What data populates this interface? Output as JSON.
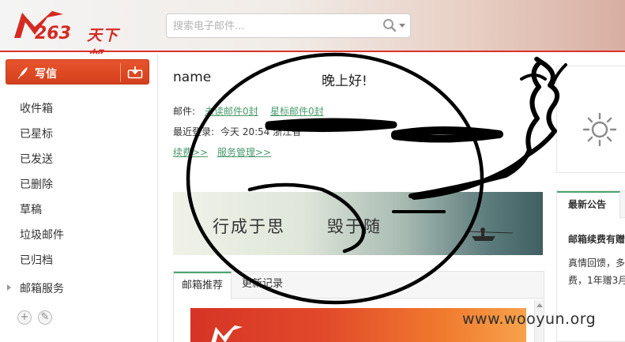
{
  "brand": {
    "logo_number": "263",
    "logo_name": "天下邮"
  },
  "search": {
    "placeholder": "搜索电子邮件..."
  },
  "sidebar": {
    "compose_label": "写信",
    "folders": [
      "收件箱",
      "已星标",
      "已发送",
      "已删除",
      "草稿",
      "垃圾邮件",
      "已归档"
    ],
    "service_label": "邮箱服务"
  },
  "main": {
    "username": "name",
    "greeting": "晚上好!",
    "mail_label": "邮件:",
    "unread_link": "未读邮件0封",
    "starred_link": "星标邮件0封",
    "last_login_label": "最近登录:",
    "last_login_value": "今天 20:54 浙江省",
    "renew_link": "续费>>",
    "service_link": "服务管理>>",
    "banner_text_1": "行成于思",
    "banner_text_2": "毁于随",
    "tabs": [
      "邮箱推荐",
      "更新记录"
    ]
  },
  "notice": {
    "tab_label": "最新公告",
    "title": "邮箱续费有赠",
    "line1": "真情回馈，多",
    "line2": "费，1年赠3月"
  },
  "watermark": "www.wooyun.org",
  "colors": {
    "brand_red": "#d9332c",
    "compose_orange": "#e0482a",
    "link_green": "#4a9a6d"
  }
}
